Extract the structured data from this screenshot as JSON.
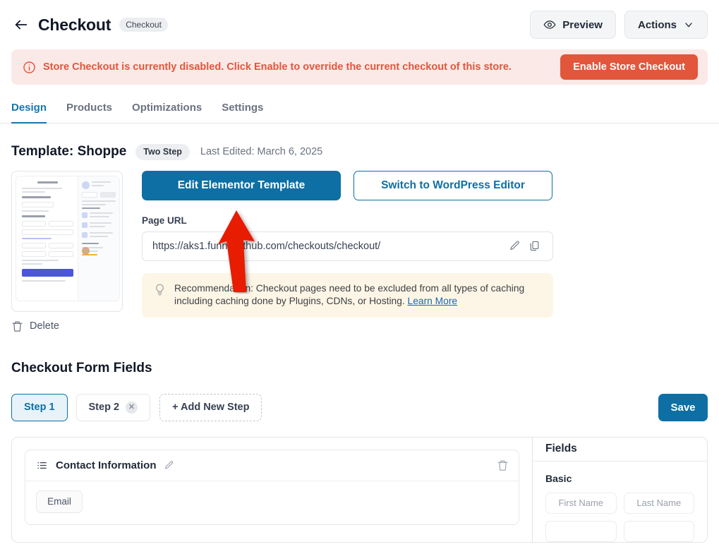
{
  "header": {
    "back_icon": "arrow-left-icon",
    "title": "Checkout",
    "chip": "Checkout",
    "preview_label": "Preview",
    "preview_icon": "eye-icon",
    "actions_label": "Actions",
    "actions_icon": "chevron-down-icon"
  },
  "alert": {
    "icon": "info-circle-icon",
    "message": "Store Checkout is currently disabled. Click Enable to override the current checkout of this store.",
    "button_label": "Enable Store Checkout",
    "bg_color": "#fbe9e7",
    "accent_color": "#e2563c"
  },
  "tabs": [
    {
      "label": "Design",
      "active": true
    },
    {
      "label": "Products",
      "active": false
    },
    {
      "label": "Optimizations",
      "active": false
    },
    {
      "label": "Settings",
      "active": false
    }
  ],
  "template": {
    "title": "Template: Shoppe",
    "chip": "Two Step",
    "last_edited": "Last Edited: March 6, 2025",
    "delete_label": "Delete",
    "delete_icon": "trash-icon",
    "edit_button": "Edit Elementor Template",
    "switch_button": "Switch to WordPress Editor",
    "url_label": "Page URL",
    "url_value": "https://aks1.funnelkithub.com/checkouts/checkout/",
    "url_edit_icon": "pencil-icon",
    "url_copy_icon": "copy-icon",
    "recommendation_icon": "lightbulb-icon",
    "recommendation_text": "Recommendation: Checkout pages need to be excluded from all types of caching including caching done by Plugins, CDNs, or Hosting. ",
    "recommendation_link": "Learn More",
    "primary_color": "#0d6fa3"
  },
  "form_fields": {
    "title": "Checkout Form Fields",
    "steps": [
      {
        "label": "Step 1",
        "active": true,
        "closable": false
      },
      {
        "label": "Step 2",
        "active": false,
        "closable": true,
        "close_icon": "close-icon"
      }
    ],
    "add_step_label": "+ Add New Step",
    "save_label": "Save",
    "section": {
      "list_icon": "list-icon",
      "name": "Contact Information",
      "edit_icon": "pencil-icon",
      "delete_icon": "trash-icon",
      "fields": [
        "Email"
      ]
    },
    "sidebar": {
      "title": "Fields",
      "group_title": "Basic",
      "chips": [
        "First Name",
        "Last Name",
        "",
        ""
      ]
    }
  },
  "annotation": {
    "type": "arrow",
    "color": "#e81f00",
    "points_to": "Edit Elementor Template"
  }
}
